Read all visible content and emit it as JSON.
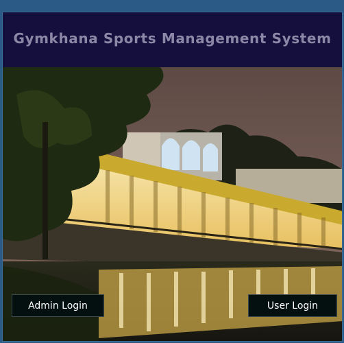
{
  "app": {
    "title": "Gymkhana Sports Management System"
  },
  "buttons": {
    "admin_login": "Admin Login",
    "user_login": "User Login"
  },
  "colors": {
    "window_border": "#2a5a85",
    "header_bg": "#140f3d",
    "title_text": "#8c87a6",
    "button_bg": "#03100f",
    "button_text": "#ffffff"
  },
  "image": {
    "subject": "night photo of illuminated building beside a lake"
  }
}
